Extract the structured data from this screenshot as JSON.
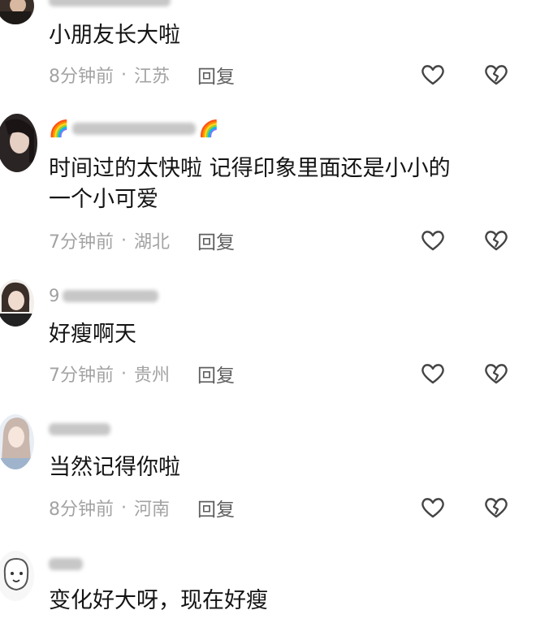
{
  "comments": [
    {
      "text": "小朋友长大啦",
      "time": "8分钟前",
      "separator": "·",
      "location": "江苏",
      "reply_label": "回复"
    },
    {
      "text_line1": "时间过的太快啦 记得印象里面还是小小的",
      "text_line2": "一个小可爱",
      "time": "7分钟前",
      "separator": "·",
      "location": "湖北",
      "reply_label": "回复"
    },
    {
      "name_prefix": "9",
      "text": "好瘦啊天",
      "time": "7分钟前",
      "separator": "·",
      "location": "贵州",
      "reply_label": "回复"
    },
    {
      "text": "当然记得你啦",
      "time": "8分钟前",
      "separator": "·",
      "location": "河南",
      "reply_label": "回复"
    },
    {
      "text": "变化好大呀，现在好瘦"
    }
  ],
  "colors": {
    "text": "#141414",
    "meta": "#a3a3a3",
    "reply": "#5f5f5f",
    "icon": "#444444"
  },
  "icons": {
    "like": "heart-outline-icon",
    "dislike": "broken-heart-icon"
  }
}
